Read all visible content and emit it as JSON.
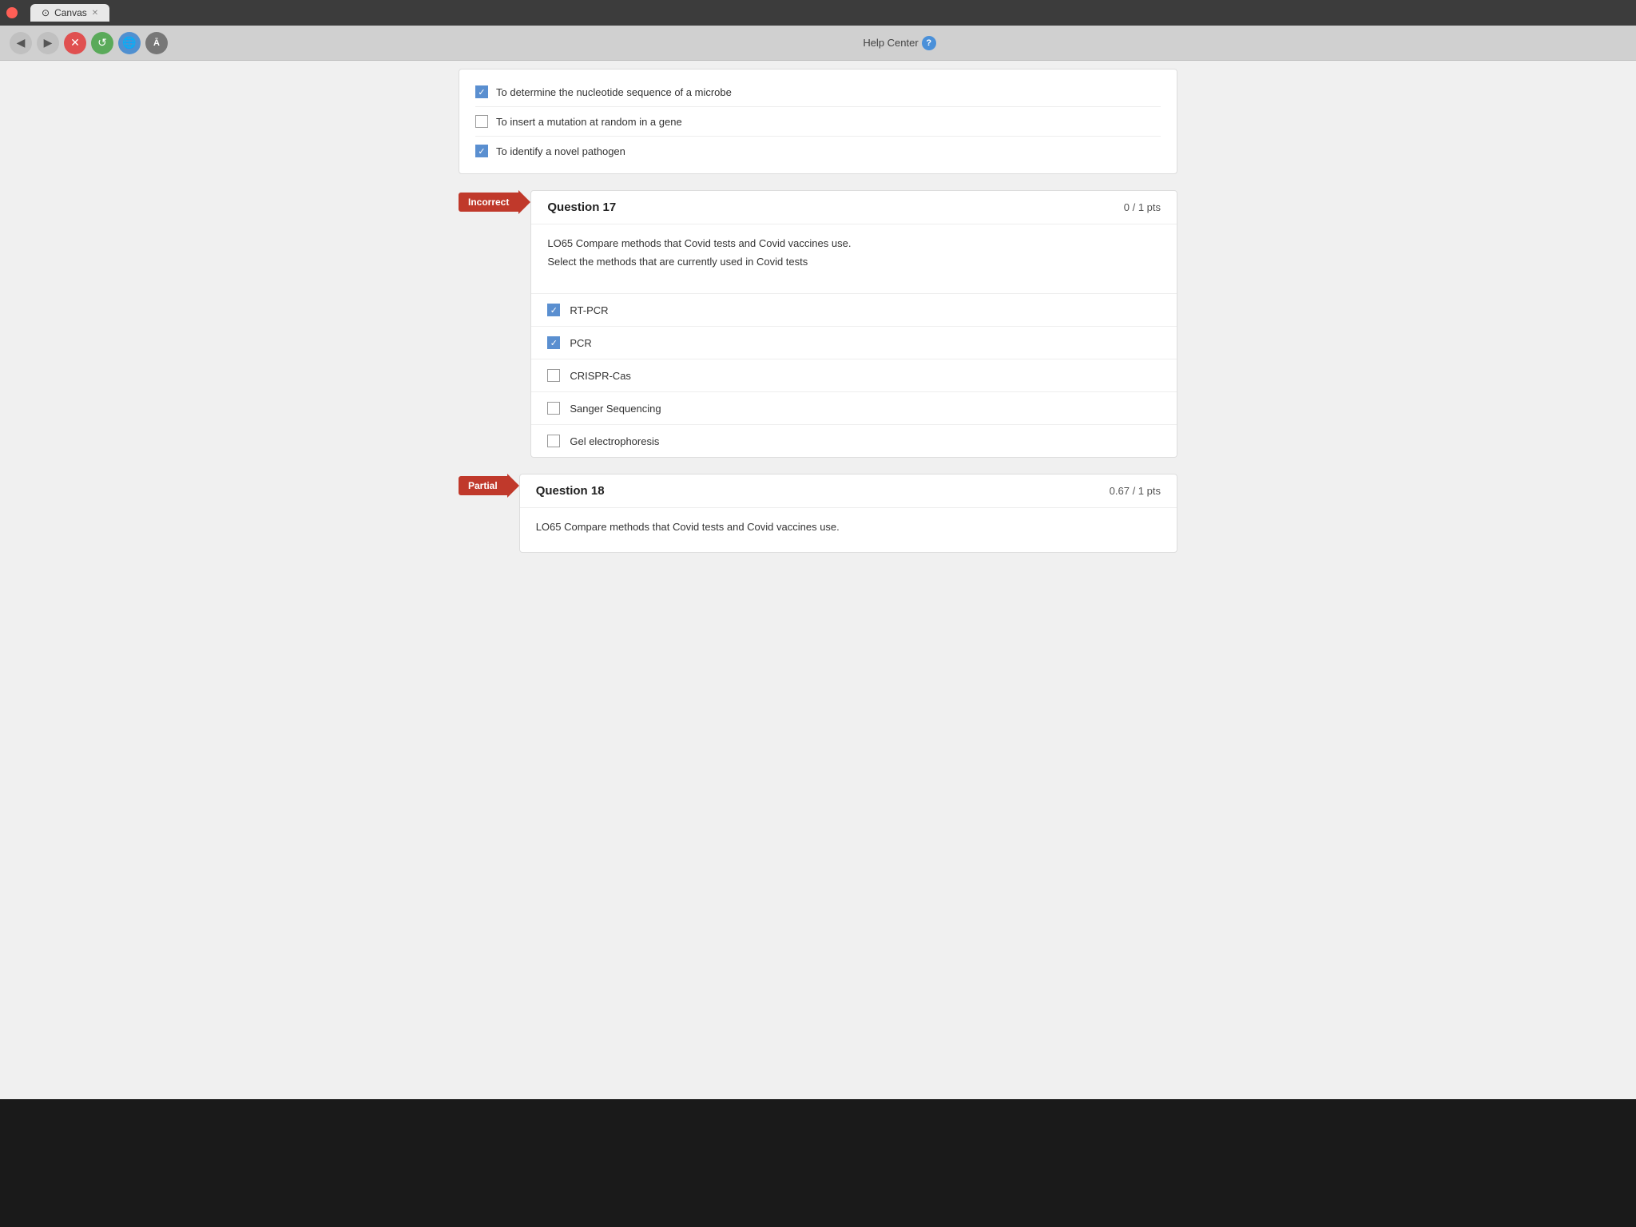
{
  "browser": {
    "tab_title": "Canvas",
    "address_bar": "Help Center",
    "nav": {
      "back_label": "◀",
      "forward_label": "▶",
      "close_label": "✕",
      "refresh_label": "↺",
      "globe_label": "🌐",
      "text_label": "Ā"
    }
  },
  "prev_question": {
    "options": [
      {
        "text": "To determine the nucleotide sequence of a microbe",
        "checked": true
      },
      {
        "text": "To insert a mutation at random in a gene",
        "checked": false
      },
      {
        "text": "To identify a novel pathogen",
        "checked": true
      }
    ]
  },
  "question17": {
    "status": "Incorrect",
    "number": "Question 17",
    "pts": "0 / 1 pts",
    "lo_text": "LO65 Compare methods that Covid tests and Covid vaccines use.",
    "instruction": "Select the methods that are currently used in Covid tests",
    "options": [
      {
        "text": "RT-PCR",
        "checked": true
      },
      {
        "text": "PCR",
        "checked": true
      },
      {
        "text": "CRISPR-Cas",
        "checked": false
      },
      {
        "text": "Sanger Sequencing",
        "checked": false
      },
      {
        "text": "Gel electrophoresis",
        "checked": false
      }
    ]
  },
  "question18": {
    "status": "Partial",
    "number": "Question 18",
    "pts": "0.67 / 1 pts",
    "lo_text": "LO65 Compare methods that Covid tests and Covid vaccines use."
  },
  "help_center_label": "Help Center"
}
